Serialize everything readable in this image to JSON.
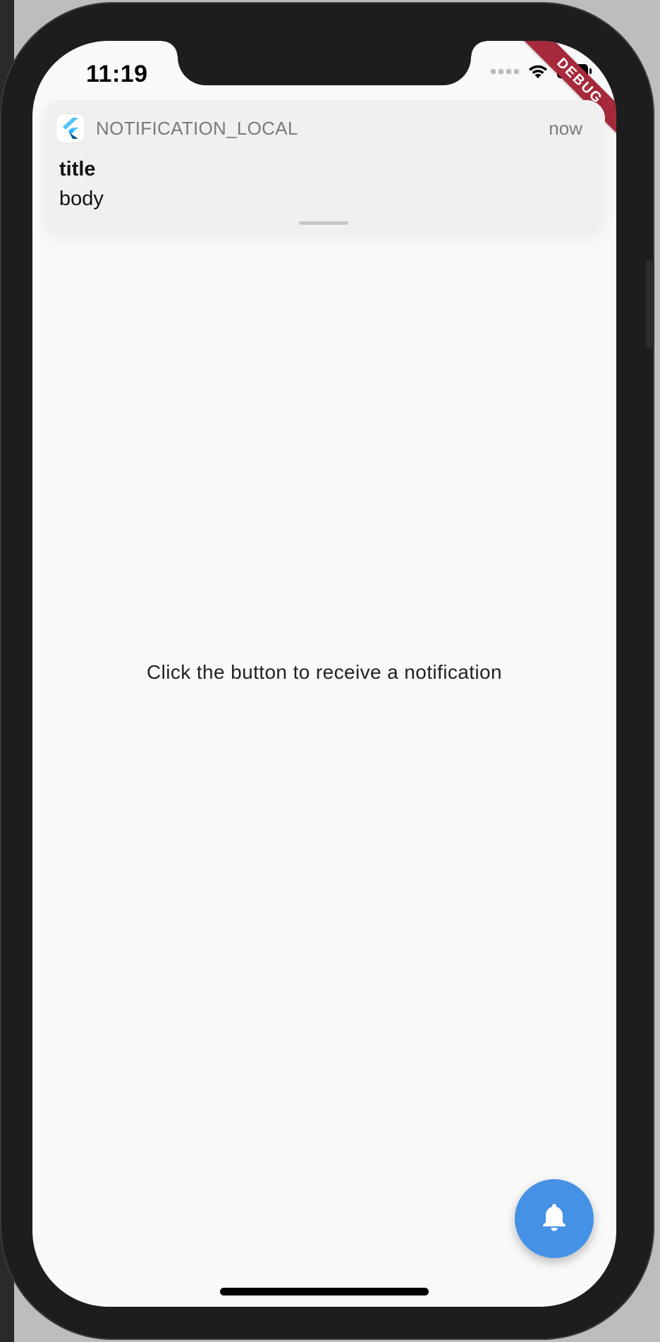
{
  "status_bar": {
    "time": "11:19",
    "wifi_icon": "wifi-icon",
    "battery_icon": "battery-icon",
    "signal_icon": "signal-dots-icon"
  },
  "debug_banner": {
    "label": "DEBUG",
    "color": "#a6293c"
  },
  "notification": {
    "app_icon": "flutter-logo-icon",
    "app_name": "NOTIFICATION_LOCAL",
    "time": "now",
    "title": "title",
    "body": "body"
  },
  "main": {
    "message": "Click the button to receive a notification"
  },
  "fab": {
    "icon": "bell-icon",
    "color": "#4591e6"
  }
}
